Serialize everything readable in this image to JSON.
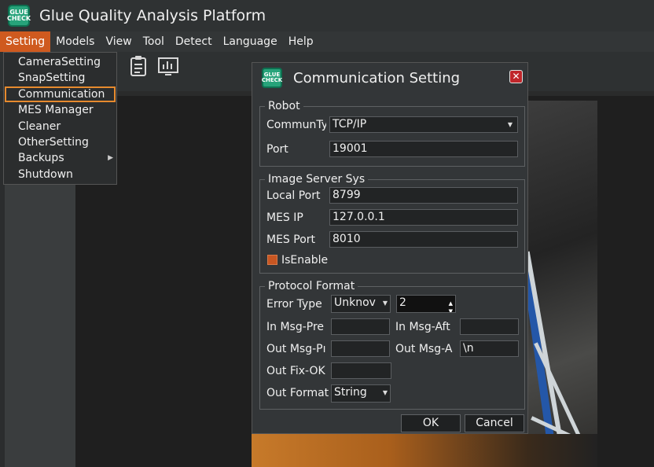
{
  "app": {
    "logo_text": "GLUE CHECK",
    "title": "Glue Quality Analysis Platform"
  },
  "menubar": {
    "items": [
      "Setting",
      "Models",
      "View",
      "Tool",
      "Detect",
      "Language",
      "Help"
    ],
    "active": "Setting"
  },
  "toolbar": {
    "icons": [
      "clipboard-icon",
      "chart-icon"
    ]
  },
  "setting_menu": {
    "items": [
      {
        "label": "CameraSetting"
      },
      {
        "label": "SnapSetting"
      },
      {
        "label": "Communication",
        "selected": true
      },
      {
        "label": "MES Manager"
      },
      {
        "label": "Cleaner"
      },
      {
        "label": "OtherSetting"
      },
      {
        "label": "Backups",
        "submenu": true
      },
      {
        "label": "Shutdown"
      }
    ]
  },
  "dialog": {
    "title": "Communication Setting",
    "close_label": "✕",
    "robot": {
      "group_title": "Robot",
      "commtype_label": "CommunTy",
      "commtype_value": "TCP/IP",
      "port_label": "Port",
      "port_value": "19001"
    },
    "image_server": {
      "group_title": "Image Server Sys",
      "local_port_label": "Local Port",
      "local_port_value": "8799",
      "mes_ip_label": "MES IP",
      "mes_ip_value": "127.0.0.1",
      "mes_port_label": "MES Port",
      "mes_port_value": "8010",
      "is_enable_label": "IsEnable",
      "is_enable_checked": true
    },
    "protocol": {
      "group_title": "Protocol Format",
      "error_type_label": "Error Type",
      "error_type_value": "Unknov",
      "error_num_value": "2",
      "in_msg_pre_label": "In Msg-Pre",
      "in_msg_pre_value": "",
      "in_msg_aft_label": "In Msg-Aft",
      "in_msg_aft_value": "",
      "out_msg_pre_label": "Out Msg-Pı",
      "out_msg_pre_value": "",
      "out_msg_aft_label": "Out Msg-A",
      "out_msg_aft_value": "\\n",
      "out_fix_ok_label": "Out Fix-OK",
      "out_fix_ok_value": "",
      "out_format_label": "Out Format",
      "out_format_value": "String"
    },
    "ok_label": "OK",
    "cancel_label": "Cancel"
  },
  "colors": {
    "accent": "#cf5a1f",
    "selection_outline": "#e68a2e",
    "close_red": "#c0262b",
    "logo_green": "#27a37a"
  }
}
